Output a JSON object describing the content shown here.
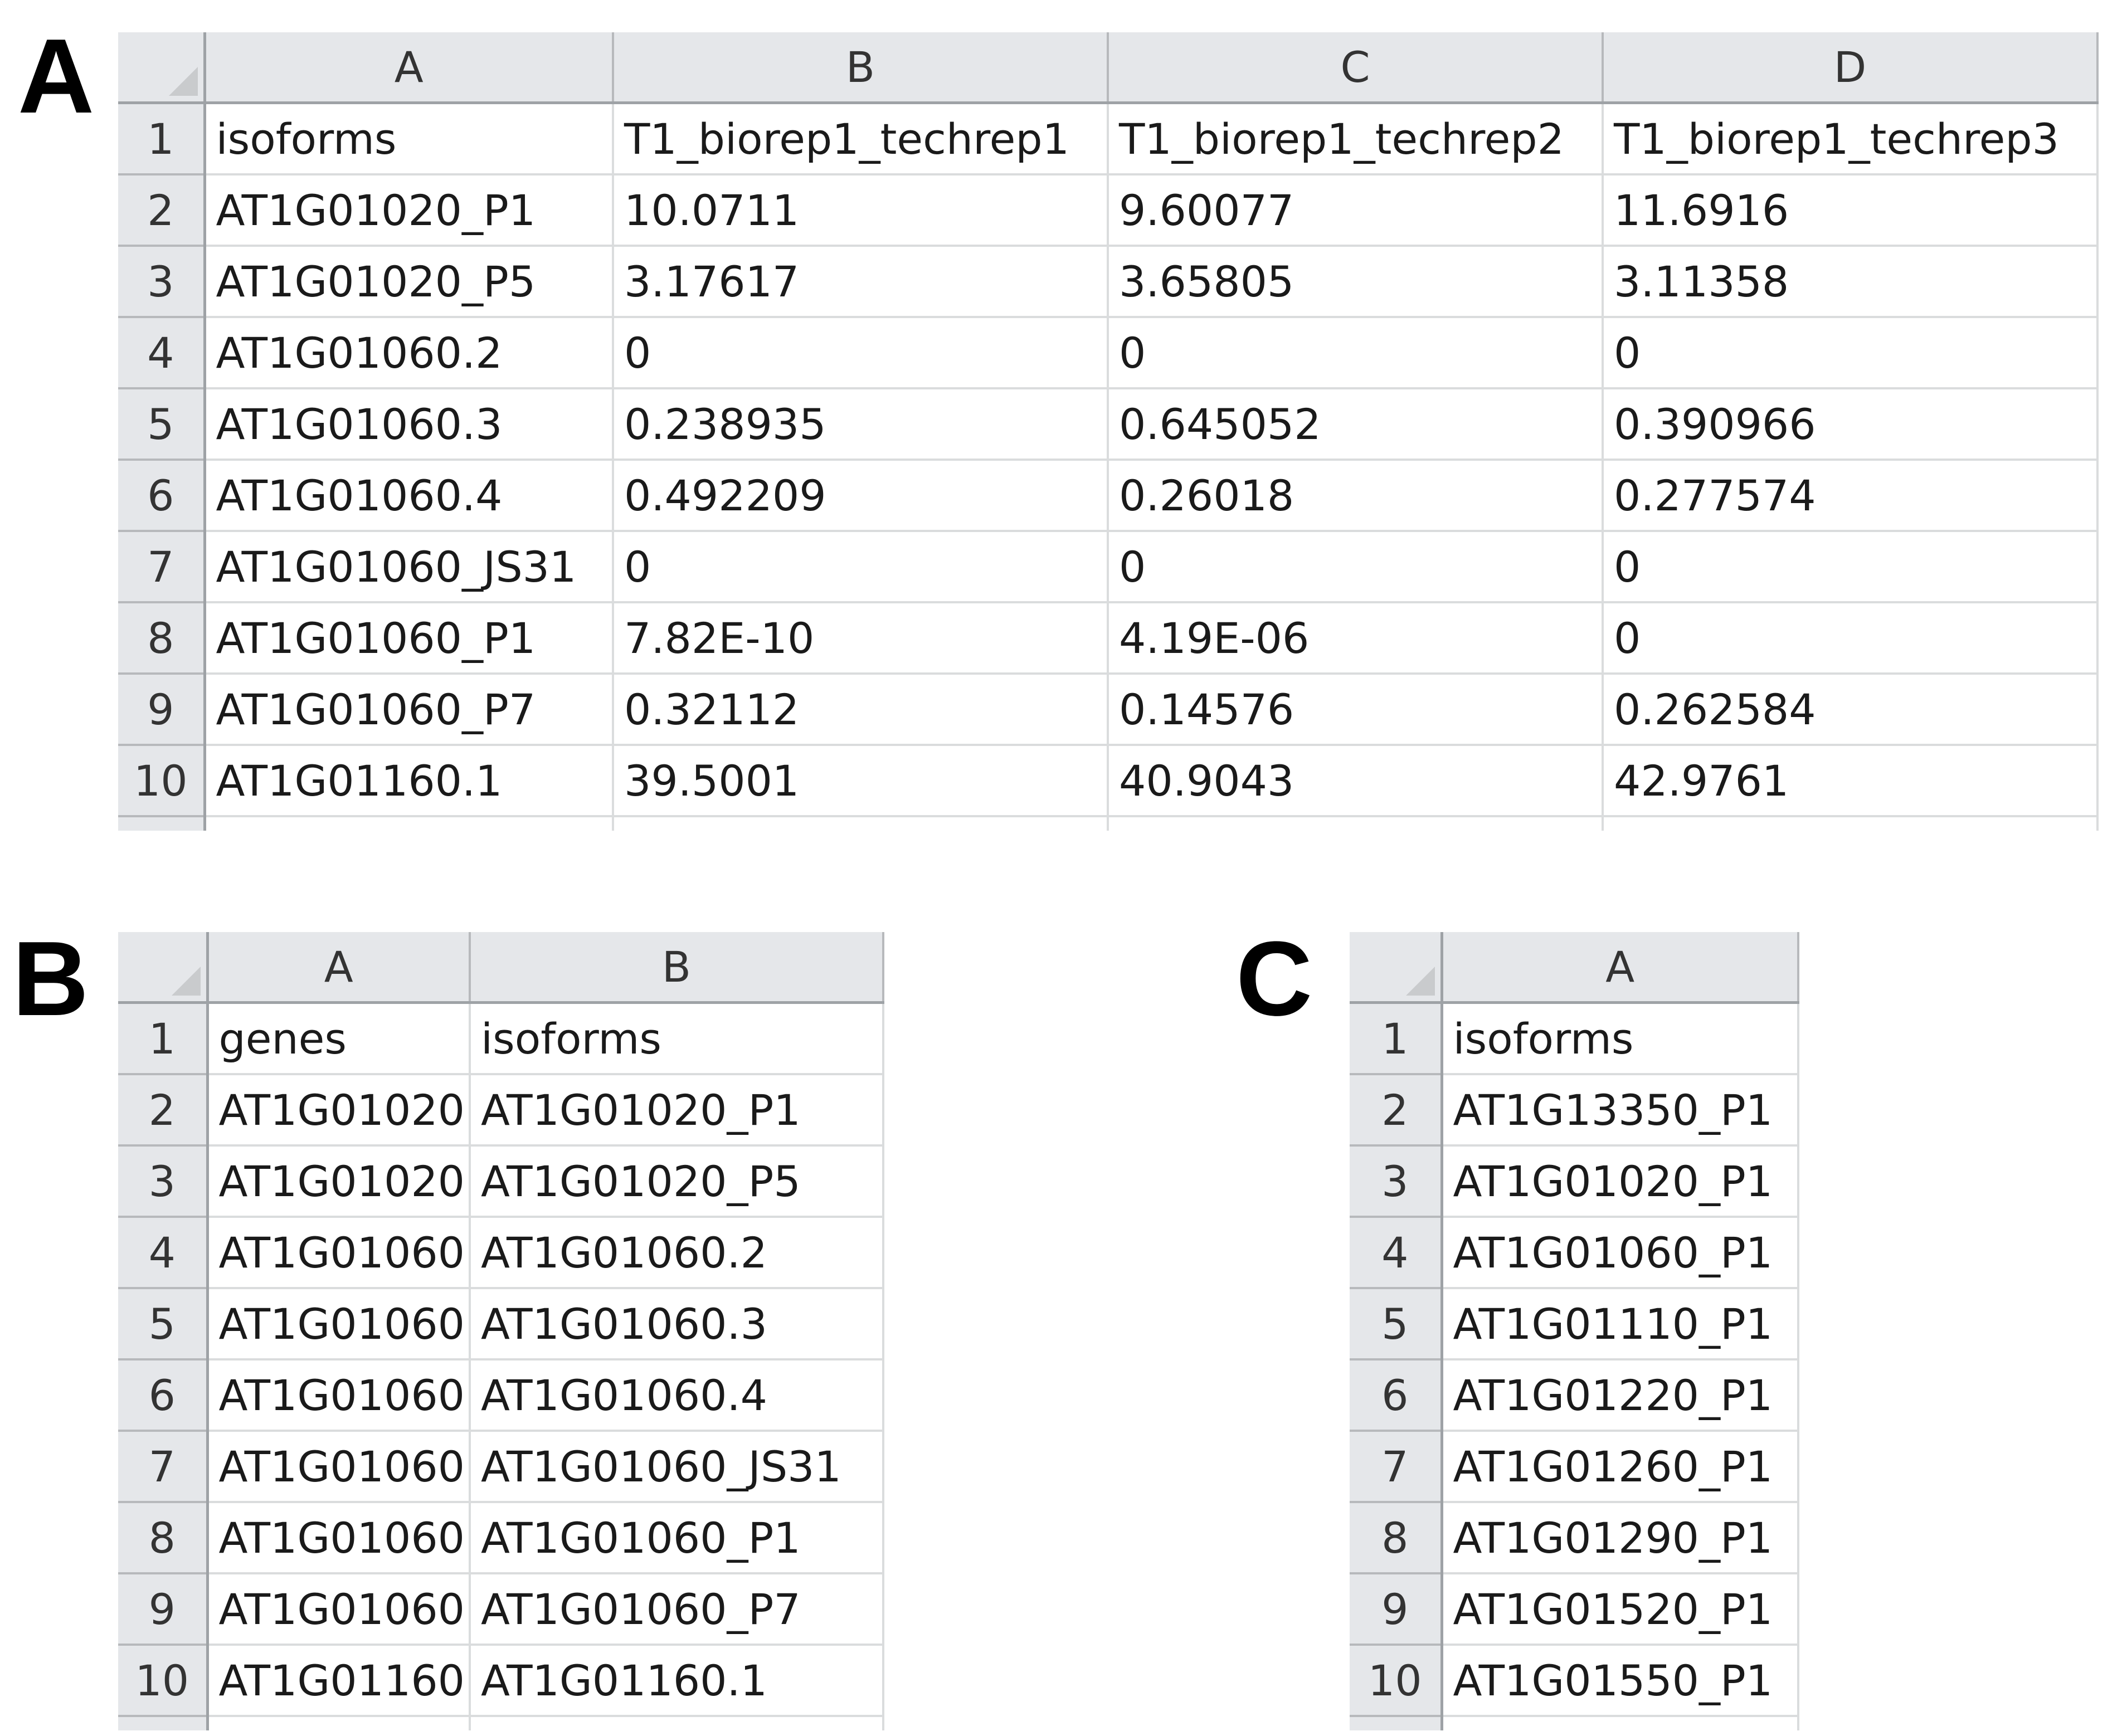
{
  "panels": {
    "a": {
      "label": "A",
      "columns": [
        "A",
        "B",
        "C",
        "D"
      ],
      "rows": [
        {
          "num": "1",
          "cells": [
            "isoforms",
            "T1_biorep1_techrep1",
            "T1_biorep1_techrep2",
            "T1_biorep1_techrep3"
          ]
        },
        {
          "num": "2",
          "cells": [
            "AT1G01020_P1",
            "10.0711",
            "9.60077",
            "11.6916"
          ]
        },
        {
          "num": "3",
          "cells": [
            "AT1G01020_P5",
            "3.17617",
            "3.65805",
            "3.11358"
          ]
        },
        {
          "num": "4",
          "cells": [
            "AT1G01060.2",
            "0",
            "0",
            "0"
          ]
        },
        {
          "num": "5",
          "cells": [
            "AT1G01060.3",
            "0.238935",
            "0.645052",
            "0.390966"
          ]
        },
        {
          "num": "6",
          "cells": [
            "AT1G01060.4",
            "0.492209",
            "0.26018",
            "0.277574"
          ]
        },
        {
          "num": "7",
          "cells": [
            "AT1G01060_JS31",
            "0",
            "0",
            "0"
          ]
        },
        {
          "num": "8",
          "cells": [
            "AT1G01060_P1",
            "7.82E-10",
            "4.19E-06",
            "0"
          ]
        },
        {
          "num": "9",
          "cells": [
            "AT1G01060_P7",
            "0.32112",
            "0.14576",
            "0.262584"
          ]
        },
        {
          "num": "10",
          "cells": [
            "AT1G01160.1",
            "39.5001",
            "40.9043",
            "42.9761"
          ]
        }
      ]
    },
    "b": {
      "label": "B",
      "columns": [
        "A",
        "B"
      ],
      "rows": [
        {
          "num": "1",
          "cells": [
            "genes",
            "isoforms"
          ]
        },
        {
          "num": "2",
          "cells": [
            "AT1G01020",
            "AT1G01020_P1"
          ]
        },
        {
          "num": "3",
          "cells": [
            "AT1G01020",
            "AT1G01020_P5"
          ]
        },
        {
          "num": "4",
          "cells": [
            "AT1G01060",
            "AT1G01060.2"
          ]
        },
        {
          "num": "5",
          "cells": [
            "AT1G01060",
            "AT1G01060.3"
          ]
        },
        {
          "num": "6",
          "cells": [
            "AT1G01060",
            "AT1G01060.4"
          ]
        },
        {
          "num": "7",
          "cells": [
            "AT1G01060",
            "AT1G01060_JS31"
          ]
        },
        {
          "num": "8",
          "cells": [
            "AT1G01060",
            "AT1G01060_P1"
          ]
        },
        {
          "num": "9",
          "cells": [
            "AT1G01060",
            "AT1G01060_P7"
          ]
        },
        {
          "num": "10",
          "cells": [
            "AT1G01160",
            "AT1G01160.1"
          ]
        }
      ]
    },
    "c": {
      "label": "C",
      "columns": [
        "A"
      ],
      "rows": [
        {
          "num": "1",
          "cells": [
            "isoforms"
          ]
        },
        {
          "num": "2",
          "cells": [
            "AT1G13350_P1"
          ]
        },
        {
          "num": "3",
          "cells": [
            "AT1G01020_P1"
          ]
        },
        {
          "num": "4",
          "cells": [
            "AT1G01060_P1"
          ]
        },
        {
          "num": "5",
          "cells": [
            "AT1G01110_P1"
          ]
        },
        {
          "num": "6",
          "cells": [
            "AT1G01220_P1"
          ]
        },
        {
          "num": "7",
          "cells": [
            "AT1G01260_P1"
          ]
        },
        {
          "num": "8",
          "cells": [
            "AT1G01290_P1"
          ]
        },
        {
          "num": "9",
          "cells": [
            "AT1G01520_P1"
          ]
        },
        {
          "num": "10",
          "cells": [
            "AT1G01550_P1"
          ]
        }
      ]
    }
  },
  "colors": {
    "header_bg": "#e5e7ea",
    "gridline": "#dadcdd",
    "header_border": "#9ea2a6"
  }
}
